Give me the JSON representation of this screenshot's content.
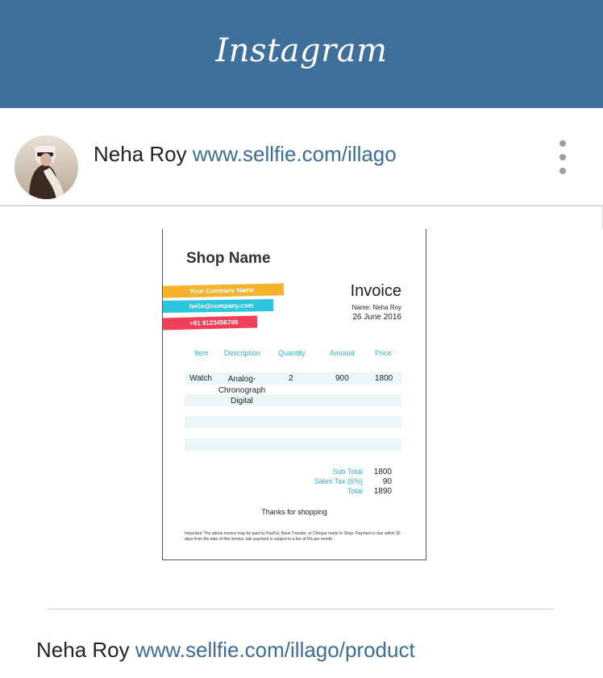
{
  "app": {
    "logo_text": "Instagram",
    "brand_color": "#3f6f9b",
    "link_color": "#3d6c95"
  },
  "post_header": {
    "user_name": "Neha Roy",
    "link_text": "www.sellfie.com/illago",
    "more_icon": "more-vertical-icon"
  },
  "invoice": {
    "shop_name": "Shop Name",
    "company_tags": [
      {
        "text": "Your Company Name",
        "color": "#f5b22d"
      },
      {
        "text": "hello@company.com",
        "color": "#2bc6dc"
      },
      {
        "text": "+91 9123456789",
        "color": "#ef3f59"
      }
    ],
    "title": "Invoice",
    "name_line": "Name: Neha Roy",
    "date": "26 June 2016",
    "columns": [
      "Item",
      "Description",
      "Quantity",
      "Amount",
      "Price"
    ],
    "rows": [
      {
        "item": "Watch",
        "description": "Analog-\nChronograph\nDigital",
        "quantity": "2",
        "amount": "900",
        "price": "1800"
      }
    ],
    "totals": [
      {
        "label": "Sub Total",
        "value": "1800"
      },
      {
        "label": "Sales Tax (5%)",
        "value": "90"
      },
      {
        "label": "Total",
        "value": "1890"
      }
    ],
    "thanks": "Thanks for shopping",
    "note": "Important: The above invoice may be paid by PayPal, Bank Transfer, or Cheque made to Shop. Payment is due within 30 days from the date of this invoice, late payment is subject to a fee of 5% per month."
  },
  "footer": {
    "user_name": "Neha Roy",
    "link_text": "www.sellfie.com/illago/product"
  }
}
